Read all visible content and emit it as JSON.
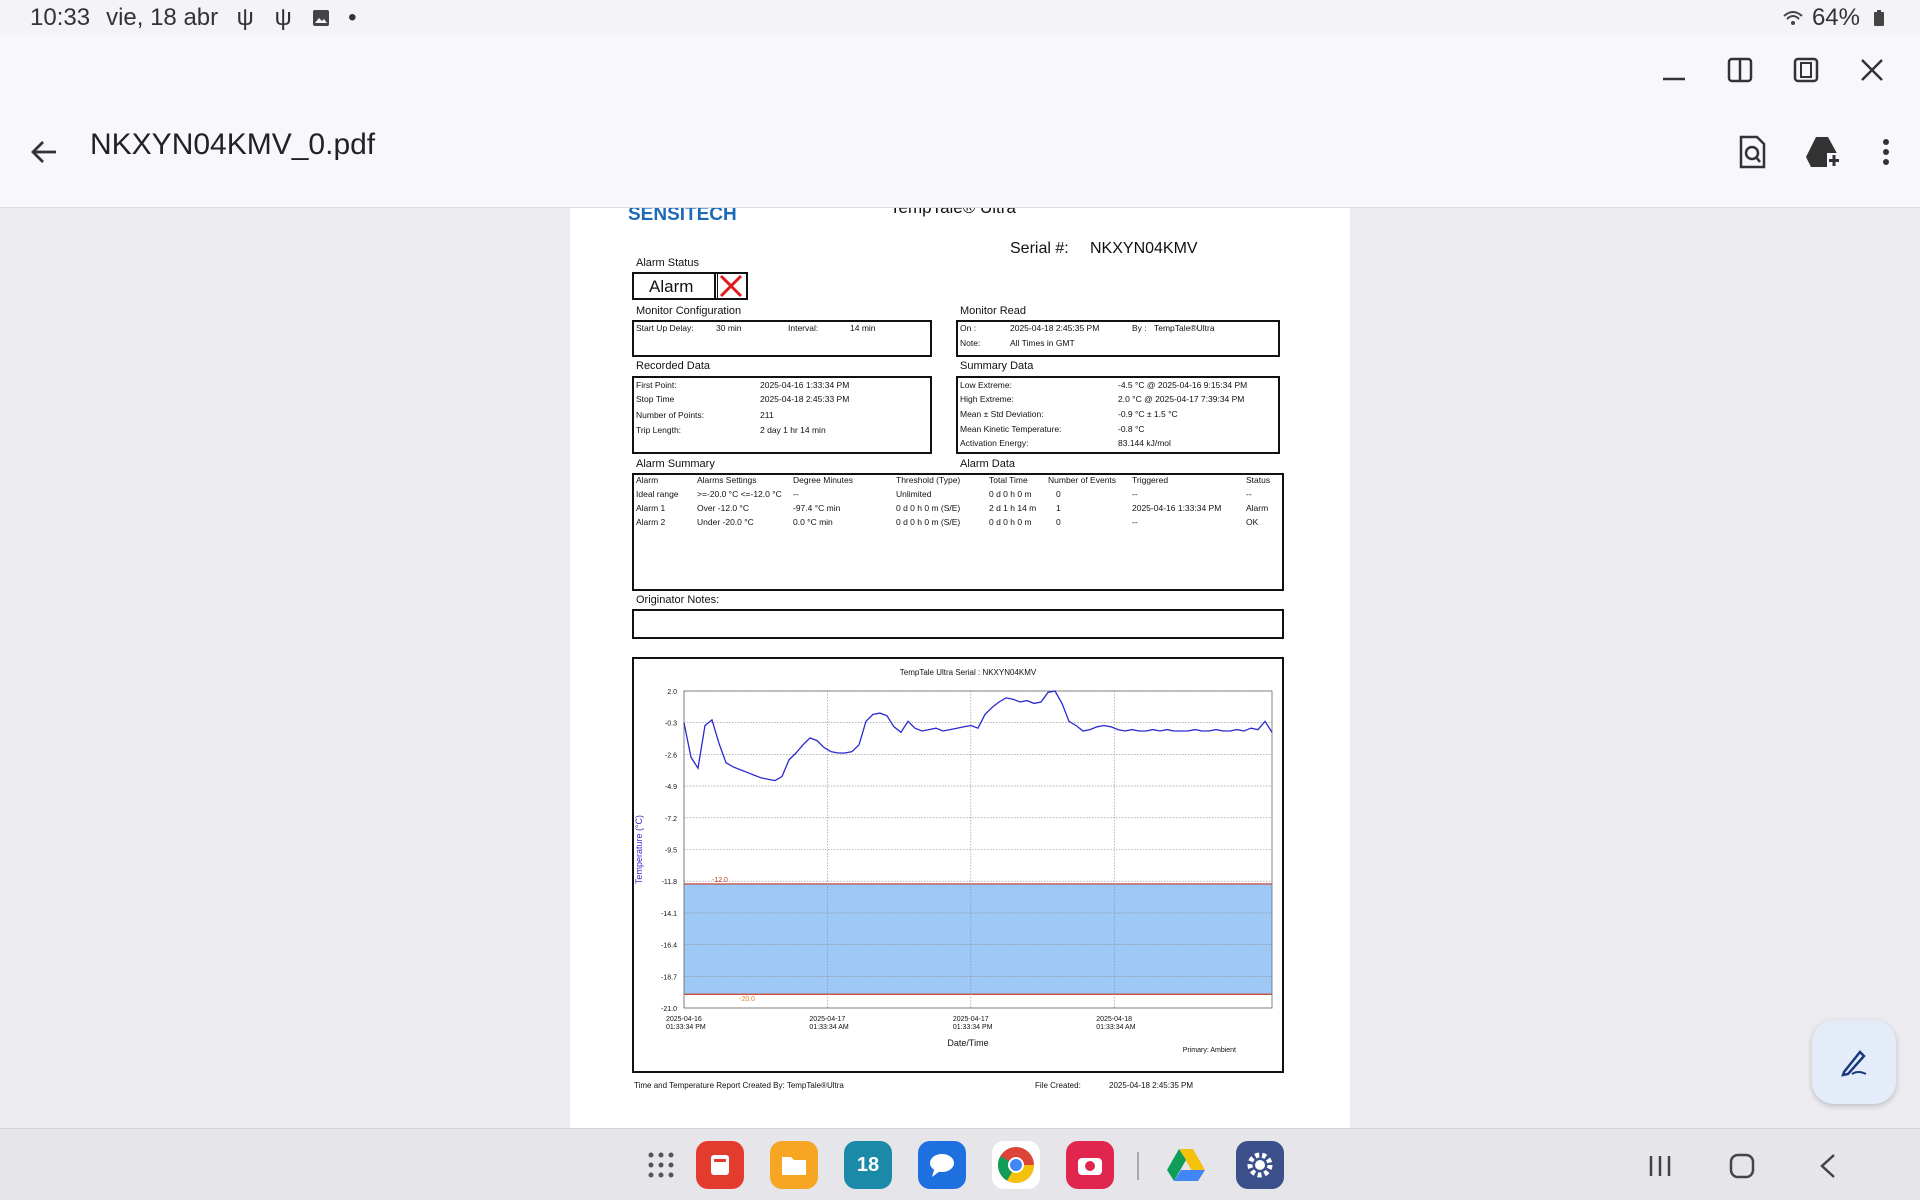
{
  "status": {
    "time": "10:33",
    "date": "vie, 18 abr",
    "battery": "64%"
  },
  "app": {
    "filename": "NKXYN04KMV_0.pdf"
  },
  "doc": {
    "logo": "SENSITECH",
    "product": "TempTale® Ultra",
    "serial_label": "Serial #:",
    "serial": "NKXYN04KMV",
    "alarm_status_label": "Alarm Status",
    "alarm_status": "Alarm",
    "monitor_config": {
      "title": "Monitor Configuration",
      "startup_label": "Start Up Delay:",
      "startup": "30 min",
      "interval_label": "Interval:",
      "interval": "14 min"
    },
    "monitor_read": {
      "title": "Monitor Read",
      "on_label": "On :",
      "on": "2025-04-18  2:45:35 PM",
      "by_label": "By :",
      "by": "TempTale®Ultra",
      "note_label": "Note:",
      "note": "All Times in GMT"
    },
    "recorded": {
      "title": "Recorded Data",
      "rows": [
        {
          "k": "First Point:",
          "v": "2025-04-16  1:33:34 PM"
        },
        {
          "k": "Stop Time",
          "v": "2025-04-18  2:45:33 PM"
        },
        {
          "k": "Number of Points:",
          "v": "211"
        },
        {
          "k": "Trip Length:",
          "v": "2 day 1 hr 14 min"
        }
      ]
    },
    "summary": {
      "title": "Summary Data",
      "rows": [
        {
          "k": "Low Extreme:",
          "v": "-4.5 °C @ 2025-04-16  9:15:34 PM"
        },
        {
          "k": "High Extreme:",
          "v": "2.0 °C @ 2025-04-17  7:39:34 PM"
        },
        {
          "k": "Mean ± Std Deviation:",
          "v": "-0.9 °C ± 1.5 °C"
        },
        {
          "k": "Mean Kinetic Temperature:",
          "v": "-0.8 °C"
        },
        {
          "k": "Activation Energy:",
          "v": "83.144 kJ/mol"
        }
      ]
    },
    "alarm_summary": {
      "title": "Alarm Summary",
      "data_title": "Alarm Data",
      "headers": [
        "Alarm",
        "Alarms Settings",
        "Degree Minutes",
        "Threshold (Type)",
        "Total Time",
        "Number of Events",
        "Triggered",
        "Status"
      ],
      "rows": [
        [
          "Ideal range",
          ">=-20.0 °C <=-12.0 °C",
          "--",
          "Unlimited",
          "0 d 0 h 0 m",
          "0",
          "--",
          "--"
        ],
        [
          "Alarm 1",
          "Over -12.0 °C",
          "-97.4 °C min",
          "0 d 0 h 0 m (S/E)",
          "2 d 1 h 14 m",
          "1",
          "2025-04-16  1:33:34 PM",
          "Alarm"
        ],
        [
          "Alarm 2",
          "Under -20.0 °C",
          "0.0 °C min",
          "0 d 0 h 0 m (S/E)",
          "0 d 0 h 0 m",
          "0",
          "--",
          "OK"
        ]
      ]
    },
    "originator_notes": "Originator Notes:",
    "footer_left": "Time and Temperature Report Created By:  TempTale®Ultra",
    "footer_mid_label": "File Created:",
    "footer_mid": "2025-04-18  2:45:35 PM"
  },
  "chart_data": {
    "type": "line",
    "title": "TempTale Ultra  Serial : NKXYN04KMV",
    "xlabel": "Date/Time",
    "ylabel": "Temperature (°C)",
    "legend": "Primary: Ambient",
    "ylim": [
      -21.0,
      2.0
    ],
    "yticks": [
      "2.0",
      "-0.3",
      "-2.6",
      "-4.9",
      "-7.2",
      "-9.5",
      "-11.8",
      "-14.1",
      "-16.4",
      "-18.7",
      "-21.0"
    ],
    "xticks": [
      [
        "2025-04-16",
        "01:33:34 PM"
      ],
      [
        "2025-04-17",
        "01:33:34 AM"
      ],
      [
        "2025-04-17",
        "01:33:34 PM"
      ],
      [
        "2025-04-18",
        "01:33:34 AM"
      ]
    ],
    "ideal_range": [
      -20.0,
      -12.0
    ],
    "threshold_labels": [
      "-12.0",
      "-20.0"
    ],
    "series": [
      {
        "name": "Ambient",
        "values": [
          -0.3,
          -2.8,
          -3.6,
          -0.5,
          -0.1,
          -1.8,
          -3.2,
          -3.5,
          -3.7,
          -3.9,
          -4.1,
          -4.3,
          -4.4,
          -4.5,
          -4.2,
          -3.0,
          -2.5,
          -1.9,
          -1.4,
          -1.6,
          -2.1,
          -2.4,
          -2.5,
          -2.5,
          -2.4,
          -1.9,
          -0.2,
          0.3,
          0.4,
          0.2,
          -0.6,
          -1.0,
          -0.2,
          -0.7,
          -0.9,
          -0.8,
          -0.7,
          -0.9,
          -0.8,
          -0.7,
          -0.6,
          -0.5,
          -0.7,
          0.3,
          0.8,
          1.2,
          1.5,
          1.4,
          1.2,
          1.3,
          1.1,
          1.2,
          1.9,
          2.0,
          1.1,
          -0.2,
          -0.5,
          -0.9,
          -0.8,
          -0.6,
          -0.5,
          -0.6,
          -0.8,
          -0.9,
          -0.8,
          -0.9,
          -0.9,
          -0.8,
          -0.9,
          -0.8,
          -0.9,
          -0.9,
          -0.9,
          -0.8,
          -0.9,
          -0.9,
          -0.8,
          -0.9,
          -0.9,
          -0.8,
          -0.9,
          -0.7,
          -0.8,
          -0.2,
          -1.0
        ]
      }
    ]
  },
  "taskbar": {
    "calendar_day": "18"
  }
}
